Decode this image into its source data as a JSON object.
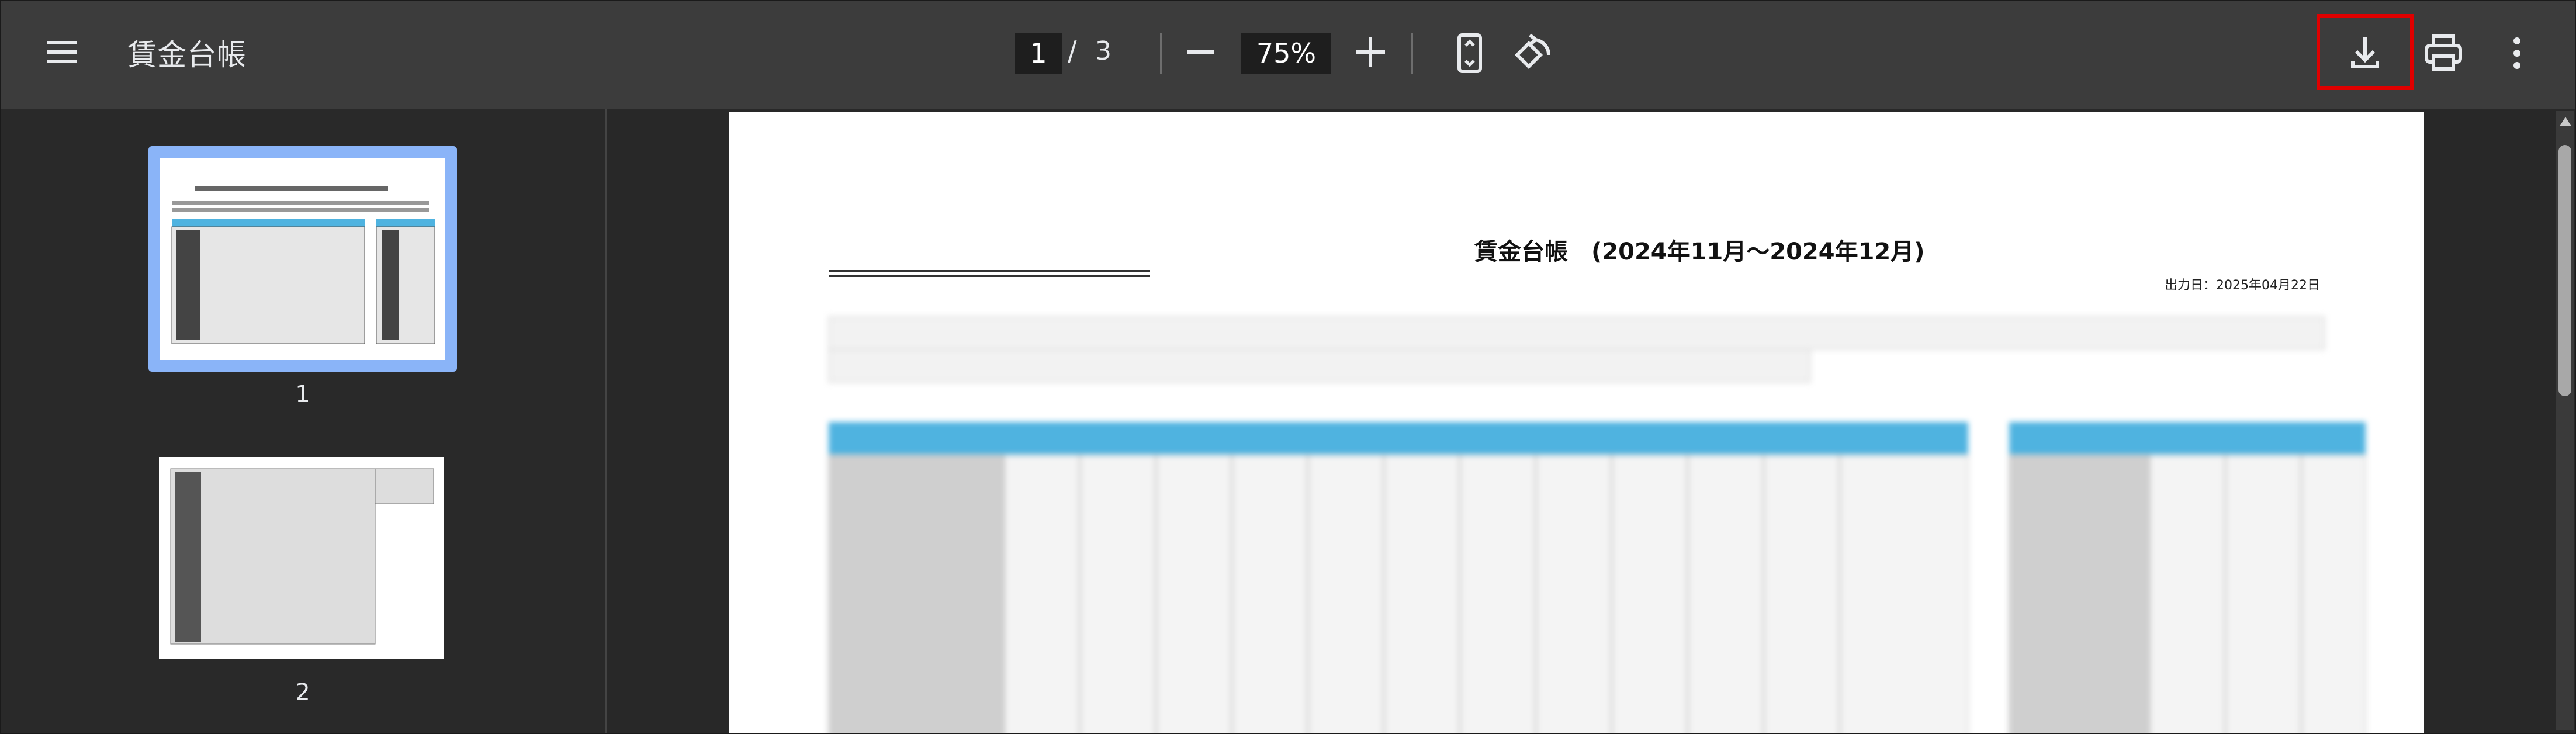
{
  "toolbar": {
    "title": "賃金台帳",
    "page_current": "1",
    "page_separator": "/",
    "page_total": "3",
    "zoom": "75%"
  },
  "sidebar": {
    "thumbnails": [
      {
        "label": "1",
        "selected": true
      },
      {
        "label": "2",
        "selected": false
      }
    ]
  },
  "document": {
    "heading": "賃金台帳　(2024年11月～2024年12月)",
    "output_date": "出力日：2025年04月22日"
  },
  "colors": {
    "toolbar_bg": "#3c3c3c",
    "sidebar_bg": "#292929",
    "main_bg": "#282828",
    "thumb_selected": "#8ab4f8",
    "highlight": "#e00000",
    "table_header": "#4fb3e0"
  },
  "icons": [
    "menu-icon",
    "zoom-out-icon",
    "zoom-in-icon",
    "fit-page-icon",
    "rotate-icon",
    "download-icon",
    "print-icon",
    "more-vert-icon"
  ]
}
